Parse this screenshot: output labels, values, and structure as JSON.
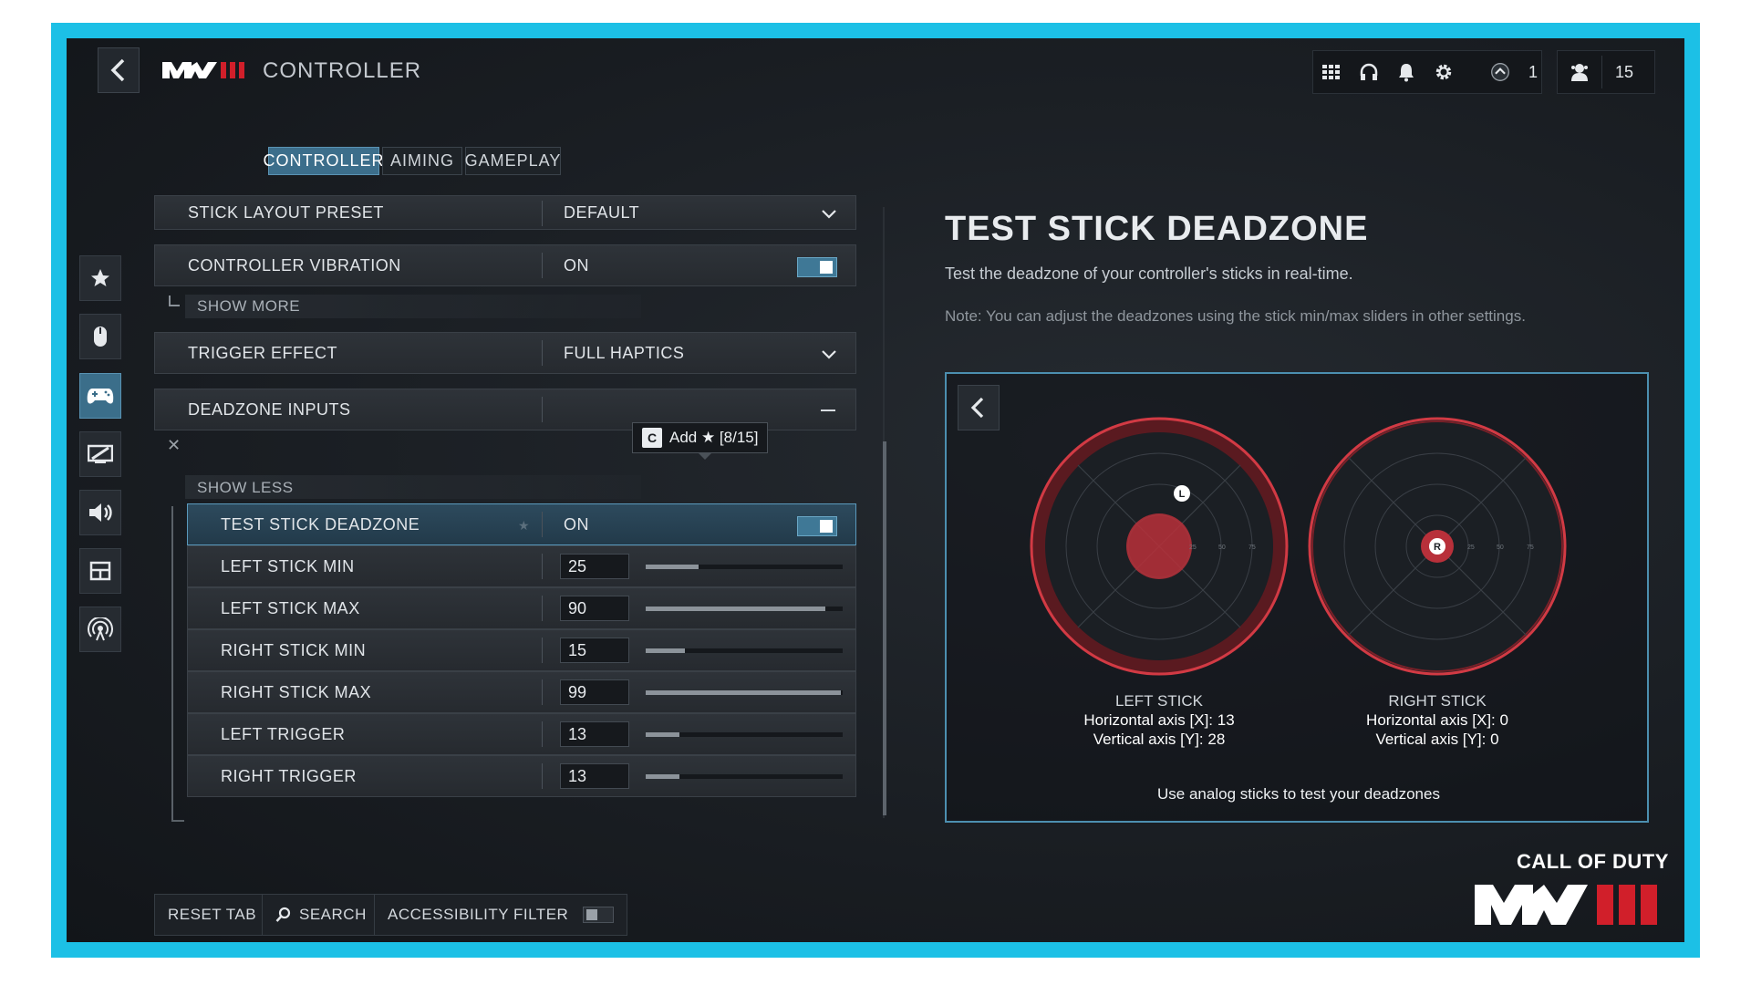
{
  "header": {
    "title": "CONTROLLER",
    "icons": [
      "grid-icon",
      "headset-icon",
      "bell-icon",
      "gear-icon",
      "rank-icon"
    ],
    "rank_value": "1",
    "player_count": "15"
  },
  "tabs": [
    {
      "label": "CONTROLLER",
      "active": true
    },
    {
      "label": "AIMING",
      "active": false
    },
    {
      "label": "GAMEPLAY",
      "active": false
    }
  ],
  "nav": [
    "star-icon",
    "mouse-icon",
    "gamepad-icon",
    "display-icon",
    "speaker-icon",
    "interface-icon",
    "network-icon"
  ],
  "settings": {
    "stick_layout": {
      "label": "STICK LAYOUT PRESET",
      "value": "DEFAULT"
    },
    "vibration": {
      "label": "CONTROLLER VIBRATION",
      "value": "ON"
    },
    "show_more": "SHOW MORE",
    "trigger_effect": {
      "label": "TRIGGER EFFECT",
      "value": "FULL HAPTICS"
    },
    "deadzone_inputs": {
      "label": "DEADZONE INPUTS"
    },
    "show_less": "SHOW LESS",
    "test_stick": {
      "label": "TEST STICK DEADZONE",
      "value": "ON"
    },
    "sliders": [
      {
        "label": "LEFT STICK MIN",
        "value": "25",
        "fill": 0.27
      },
      {
        "label": "LEFT STICK MAX",
        "value": "90",
        "fill": 0.91
      },
      {
        "label": "RIGHT STICK MIN",
        "value": "15",
        "fill": 0.2
      },
      {
        "label": "RIGHT STICK MAX",
        "value": "99",
        "fill": 0.99
      },
      {
        "label": "LEFT TRIGGER",
        "value": "13",
        "fill": 0.17
      },
      {
        "label": "RIGHT TRIGGER",
        "value": "13",
        "fill": 0.17
      }
    ]
  },
  "tooltip": {
    "key": "C",
    "text": "Add ★ [8/15]"
  },
  "test_panel": {
    "title": "TEST STICK DEADZONE",
    "description": "Test the deadzone of your controller's sticks in real-time.",
    "note": "Note: You can adjust the deadzones using the stick min/max sliders in other settings.",
    "left": {
      "name": "LEFT STICK",
      "marker": "L",
      "h": "Horizontal axis [X]: 13",
      "v": "Vertical axis [Y]: 28"
    },
    "right": {
      "name": "RIGHT STICK",
      "marker": "R",
      "h": "Horizontal axis [X]: 0",
      "v": "Vertical axis [Y]: 0"
    },
    "ring_labels": [
      "25",
      "50",
      "75"
    ],
    "footer": "Use analog sticks to test your deadzones"
  },
  "footer": {
    "reset": "RESET TAB",
    "search": "SEARCH",
    "accessibility": "ACCESSIBILITY FILTER"
  },
  "brand": {
    "cod": "CALL OF DUTY"
  },
  "colors": {
    "accent": "#3c6e8b",
    "frame": "#1cc0e6",
    "deadzone_red": "#b8303a"
  }
}
